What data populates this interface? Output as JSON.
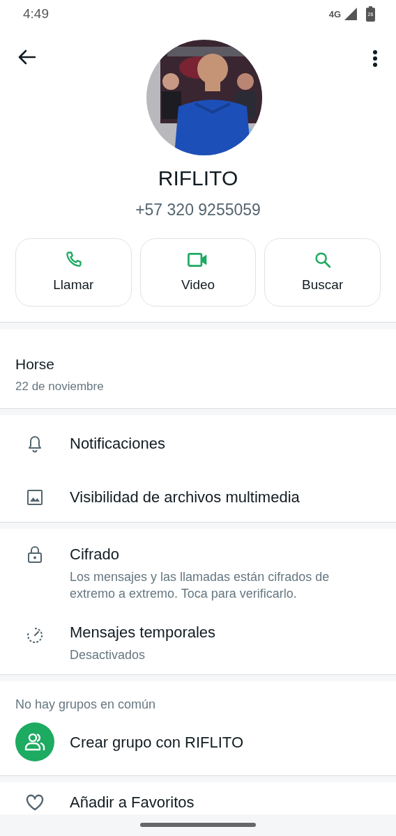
{
  "status_bar": {
    "time": "4:49",
    "network": "4G",
    "battery": "26"
  },
  "contact": {
    "name": "RIFLITO",
    "phone": "+57 320 9255059"
  },
  "actions": [
    {
      "kind": "call",
      "label": "Llamar"
    },
    {
      "kind": "video",
      "label": "Video"
    },
    {
      "kind": "search",
      "label": "Buscar"
    }
  ],
  "about": {
    "text": "Horse",
    "date": "22 de noviembre"
  },
  "settings": [
    {
      "kind": "bell",
      "title": "Notificaciones"
    },
    {
      "kind": "media",
      "title": "Visibilidad de archivos multimedia"
    }
  ],
  "privacy": [
    {
      "kind": "lock",
      "title": "Cifrado",
      "subtitle": "Los mensajes y las llamadas están cifrados de extremo a extremo. Toca para verificarlo."
    },
    {
      "kind": "timer",
      "title": "Mensajes temporales",
      "subtitle": "Desactivados"
    }
  ],
  "groups": {
    "heading": "No hay grupos en común",
    "action": "Crear grupo con RIFLITO"
  },
  "favorites": {
    "kind": "heart",
    "title": "Añadir a Favoritos"
  }
}
